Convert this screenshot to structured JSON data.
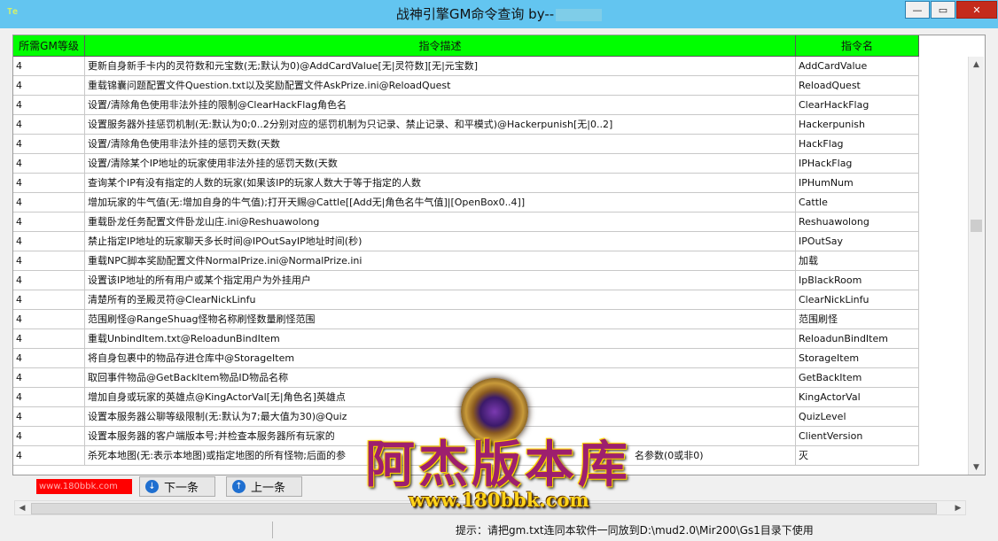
{
  "window": {
    "title": "战神引擎GM命令查询  by--",
    "app_icon": "Te",
    "minimize_glyph": "—",
    "maximize_glyph": "▭",
    "close_glyph": "✕"
  },
  "table": {
    "headers": [
      "所需GM等级",
      "指令描述",
      "指令名"
    ],
    "rows": [
      {
        "level": "4",
        "desc": "更新自身新手卡内的灵符数和元宝数(无;默认为0)@AddCardValue[无|灵符数][无|元宝数]",
        "name": "AddCardValue"
      },
      {
        "level": "4",
        "desc": "重载锦囊问题配置文件Question.txt以及奖励配置文件AskPrize.ini@ReloadQuest",
        "name": "ReloadQuest"
      },
      {
        "level": "4",
        "desc": "设置/清除角色使用非法外挂的限制@ClearHackFlag角色名",
        "name": "ClearHackFlag"
      },
      {
        "level": "4",
        "desc": "设置服务器外挂惩罚机制(无:默认为0;0..2分别对应的惩罚机制为只记录、禁止记录、和平模式)@Hackerpunish[无|0..2]",
        "name": "Hackerpunish"
      },
      {
        "level": "4",
        "desc": "设置/清除角色使用非法外挂的惩罚天数(天数",
        "name": "HackFlag"
      },
      {
        "level": "4",
        "desc": "设置/清除某个IP地址的玩家使用非法外挂的惩罚天数(天数",
        "name": "IPHackFlag"
      },
      {
        "level": "4",
        "desc": "查询某个IP有没有指定的人数的玩家(如果该IP的玩家人数大于等于指定的人数",
        "name": "IPHumNum"
      },
      {
        "level": "4",
        "desc": "增加玩家的牛气值(无:增加自身的牛气值);打开天赐@Cattle[[Add无|角色名牛气值]|[OpenBox0..4]]",
        "name": "Cattle"
      },
      {
        "level": "4",
        "desc": "重载卧龙任务配置文件卧龙山庄.ini@Reshuawolong",
        "name": "Reshuawolong"
      },
      {
        "level": "4",
        "desc": "禁止指定IP地址的玩家聊天多长时间@IPOutSayIP地址时间(秒)",
        "name": "IPOutSay"
      },
      {
        "level": "4",
        "desc": "重载NPC脚本奖励配置文件NormalPrize.ini@NormalPrize.ini",
        "name": "加载"
      },
      {
        "level": "4",
        "desc": "设置该IP地址的所有用户或某个指定用户为外挂用户",
        "name": "IpBlackRoom"
      },
      {
        "level": "4",
        "desc": "清楚所有的圣殿灵符@ClearNickLinfu",
        "name": "ClearNickLinfu"
      },
      {
        "level": "4",
        "desc": "范围刷怪@RangeShuag怪物名称刷怪数量刷怪范围",
        "name": "范围刷怪"
      },
      {
        "level": "4",
        "desc": "重载UnbindItem.txt@ReloadunBindItem",
        "name": "ReloadunBindItem"
      },
      {
        "level": "4",
        "desc": "将自身包裹中的物品存进仓库中@StorageItem",
        "name": "StorageItem"
      },
      {
        "level": "4",
        "desc": "取回事件物品@GetBackItem物品ID物品名称",
        "name": "GetBackItem"
      },
      {
        "level": "4",
        "desc": "增加自身或玩家的英雄点@KingActorVal[无|角色名]英雄点",
        "name": "KingActorVal"
      },
      {
        "level": "4",
        "desc": "设置本服务器公聊等级限制(无:默认为7;最大值为30)@Quiz",
        "name": "QuizLevel"
      },
      {
        "level": "4",
        "desc": "设置本服务器的客户端版本号;并检查本服务器所有玩家的",
        "name": "ClientVersion"
      },
      {
        "level": "4",
        "desc": "杀死本地图(无:表示本地图)或指定地图的所有怪物;后面的参",
        "name": "灭"
      }
    ],
    "row_tail_fragment": "名参数(0或非0)"
  },
  "scrollbars": {
    "up_arrow": "▲",
    "down_arrow": "▼",
    "left_arrow": "◀",
    "right_arrow": "▶"
  },
  "controls": {
    "site_label": "www.180bbk.com",
    "next_label": "下一条",
    "next_icon": "↓",
    "prev_label": "上一条",
    "prev_icon": "↑"
  },
  "status_bar": {
    "text": "提示：请把gm.txt连同本软件一同放到D:\\mud2.0\\Mir200\\Gs1目录下使用"
  },
  "watermark": {
    "text": "阿杰版本库",
    "url": "www.180bbk.com"
  },
  "colors": {
    "titlebar": "#63c5f0",
    "header_bg": "#00ff00",
    "close_button": "#c42b1c",
    "site_label_bg": "#ff0000",
    "watermark_text": "#9d1f6e",
    "watermark_url": "#ffd41a"
  },
  "icons": {
    "next_icon": "arrow-down-circle-icon",
    "prev_icon": "arrow-up-circle-icon",
    "logo_emblem": "dragon-emblem-icon"
  }
}
